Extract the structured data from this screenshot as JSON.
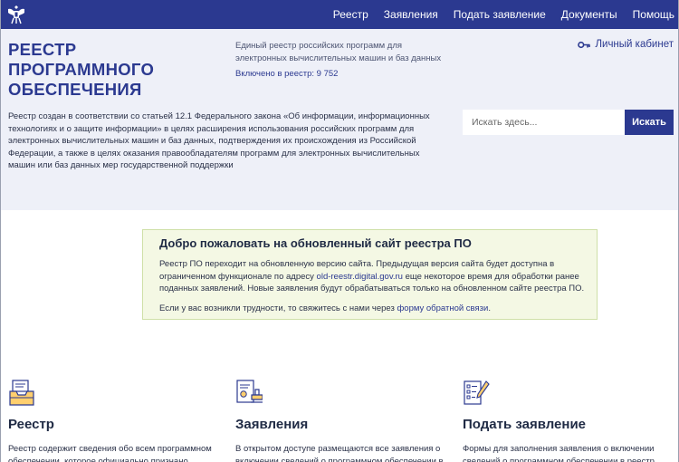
{
  "header": {
    "nav": [
      "Реестр",
      "Заявления",
      "Подать заявление",
      "Документы",
      "Помощь"
    ]
  },
  "hero": {
    "title_lines": [
      "РЕЕСТР",
      "ПРОГРАММНОГО",
      "ОБЕСПЕЧЕНИЯ"
    ],
    "registry_description": "Единый реестр российских программ для электронных вычислительных машин и баз данных",
    "registry_count": "Включено в реестр: 9 752",
    "cabinet_label": "Личный кабинет",
    "description": "Реестр создан в соответствии со статьей 12.1 Федерального закона «Об информации, информационных технологиях и о защите информации» в целях расширения использования российских программ для электронных вычислительных машин и баз данных, подтверждения их происхождения из Российской Федерации, а также в целях оказания правообладателям программ для электронных вычислительных машин или баз данных мер государственной поддержки",
    "search_placeholder": "Искать здесь...",
    "search_button": "Искать"
  },
  "notice": {
    "title": "Добро пожаловать на обновленный сайт реестра ПО",
    "p1_before": "Реестр ПО переходит на обновленную версию сайта. Предыдущая версия сайта будет доступна в ограниченном функционале по адресу ",
    "p1_link": "old-reestr.digital.gov.ru",
    "p1_after": " еще некоторое время для обработки ранее поданных заявлений. Новые заявления будут обрабатываться только на обновленном сайте реестра ПО.",
    "p2_before": "Если у вас возникли трудности, то свяжитесь с нами через ",
    "p2_link": "форму обратной связи",
    "p2_after": "."
  },
  "features": [
    {
      "title": "Реестр",
      "description": "Реестр содержит сведения обо всем программном обеспечении, которое официально признано",
      "icon": "registry-box-icon"
    },
    {
      "title": "Заявления",
      "description": "В открытом доступе размещаются все заявления о включении сведений о программном обеспечении в",
      "icon": "certificate-stamp-icon"
    },
    {
      "title": "Подать заявление",
      "description": "Формы для заполнения заявления о включении сведений о программном обеспечении в реестр",
      "icon": "checklist-pen-icon"
    }
  ],
  "colors": {
    "brand": "#2b3990",
    "hero_background": "#eef0f8",
    "notice_background": "#f4f8e4"
  }
}
